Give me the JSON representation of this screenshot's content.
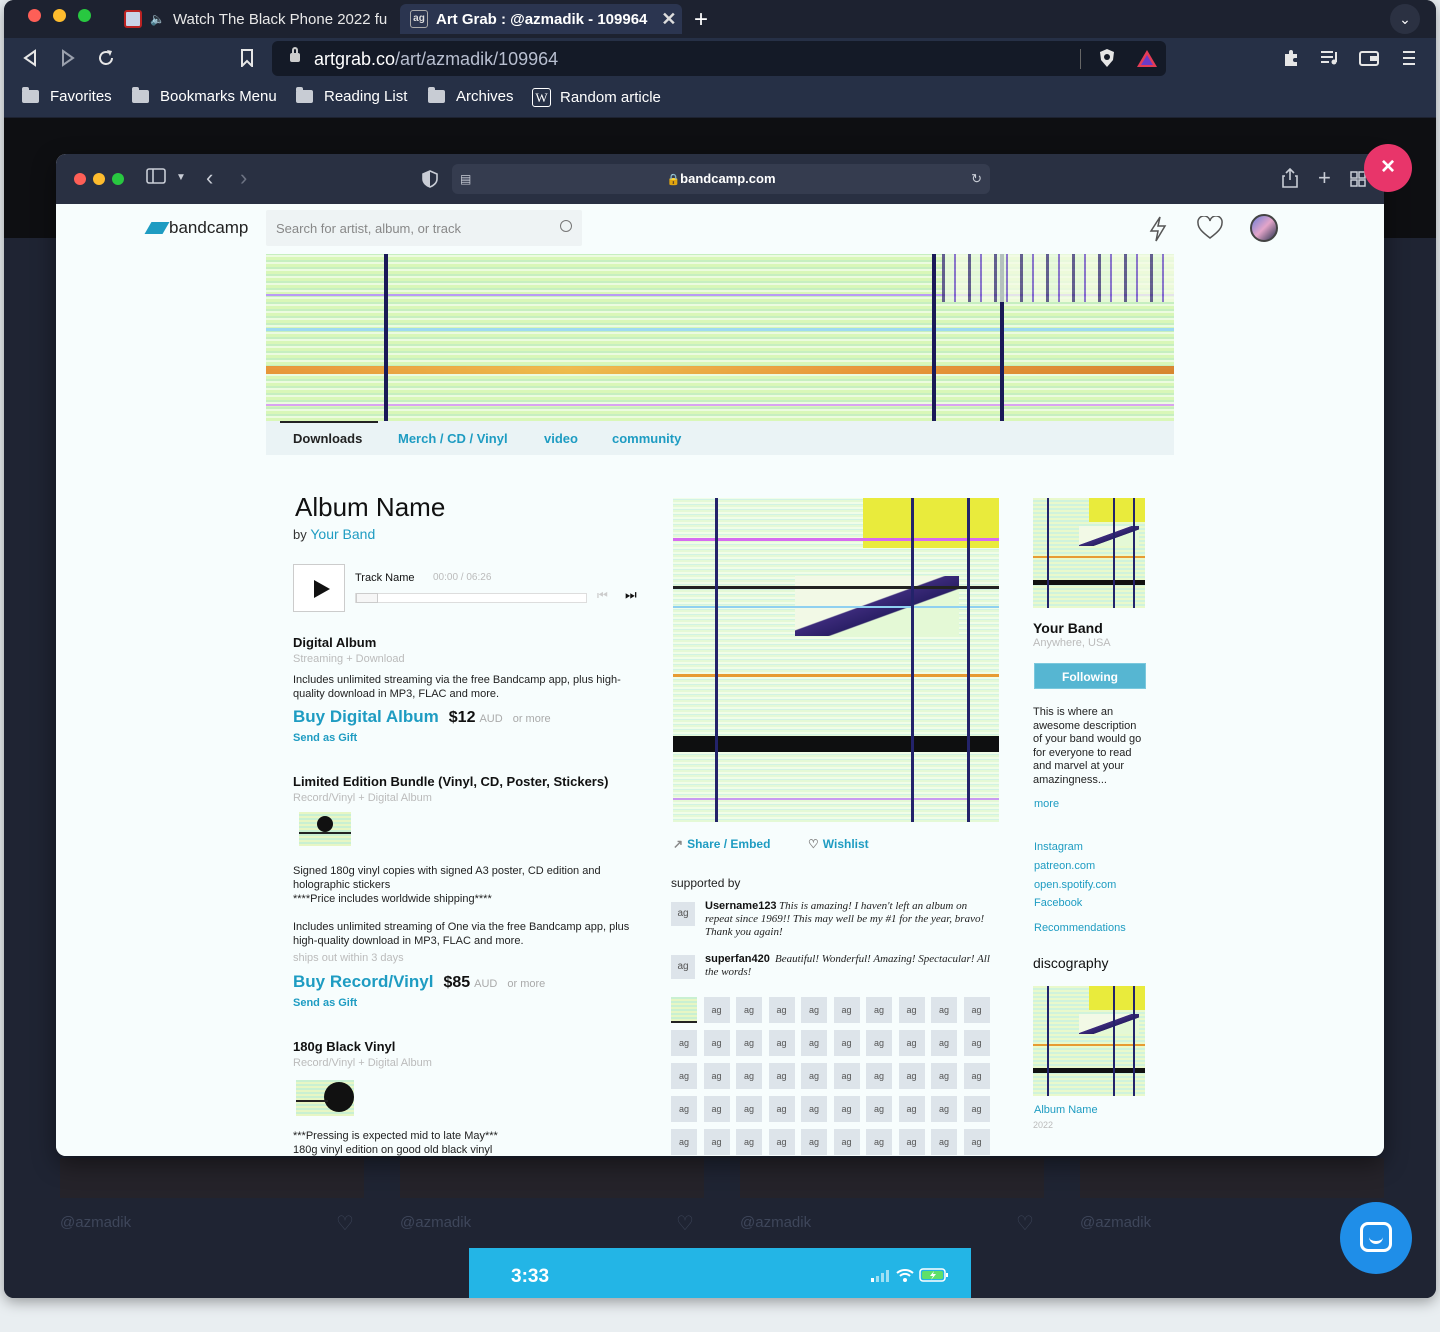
{
  "browser": {
    "tabs": [
      {
        "label": "Watch The Black Phone 2022 fu",
        "audio": "🔈"
      },
      {
        "label": "Art Grab : @azmadik - 109964",
        "close": "✕"
      }
    ],
    "new_tab": "+",
    "tab_menu": "⌄",
    "url_domain": "artgrab.co",
    "url_path": "/art/azmadik/109964",
    "bookmarks": [
      {
        "label": "Favorites",
        "icon": "folder-icon"
      },
      {
        "label": "Bookmarks Menu",
        "icon": "folder-icon"
      },
      {
        "label": "Reading List",
        "icon": "folder-icon"
      },
      {
        "label": "Archives",
        "icon": "folder-icon"
      },
      {
        "label": "Random article",
        "icon": "wikipedia-icon",
        "icon_glyph": "W"
      }
    ]
  },
  "overlay": {
    "close_glyph": "×",
    "usernames": [
      "@azmadik",
      "@azmadik",
      "@azmadik",
      "@azmadik"
    ],
    "phone_time": "3:33"
  },
  "inner_window": {
    "address": "bandcamp.com"
  },
  "bandcamp": {
    "logo": "bandcamp",
    "search_placeholder": "Search for artist, album, or track",
    "tabs": [
      "Downloads",
      "Merch / CD / Vinyl",
      "video",
      "community"
    ],
    "album_title": "Album Name",
    "by_prefix": "by",
    "artist": "Your Band",
    "player": {
      "track": "Track Name",
      "time": "00:00 / 06:26"
    },
    "digital": {
      "title": "Digital Album",
      "subtitle": "Streaming + Download",
      "desc": "Includes unlimited streaming via the free Bandcamp app, plus high-quality download in MP3, FLAC and more.",
      "buy": "Buy Digital Album",
      "price": "$12",
      "currency": "AUD",
      "more": "or more",
      "gift": "Send as Gift"
    },
    "bundle": {
      "title": "Limited Edition Bundle (Vinyl, CD, Poster, Stickers)",
      "subtitle": "Record/Vinyl + Digital Album",
      "desc1": "Signed 180g vinyl copies with signed A3 poster, CD edition and holographic stickers",
      "desc2": "****Price includes worldwide shipping****",
      "desc3": "Includes unlimited streaming of One via the free Bandcamp app, plus high-quality download in MP3, FLAC and more.",
      "ships": "ships out within 3 days",
      "buy": "Buy Record/Vinyl",
      "price": "$85",
      "currency": "AUD",
      "more": "or more",
      "gift": "Send as Gift"
    },
    "vinyl": {
      "title": "180g Black Vinyl",
      "subtitle": "Record/Vinyl + Digital Album",
      "desc1": "***Pressing is expected mid to late May***",
      "desc2": "180g vinyl edition on good old black vinyl"
    },
    "share": "Share / Embed",
    "wishlist": "Wishlist",
    "supported_by": "supported by",
    "supporters": [
      {
        "name": "Username123",
        "comment": "This is amazing! I haven't left an album on repeat since 1969!! This may well be my #1 for the year, bravo! Thank you again!"
      },
      {
        "name": "superfan420",
        "comment": "Beautiful! Wonderful! Amazing! Spectacular! All the words!"
      }
    ],
    "supporter_avatar_glyph": "ag",
    "band": {
      "name": "Your Band",
      "location": "Anywhere, USA",
      "follow": "Following",
      "description": "This is where an awesome description of your band would go for everyone to read and marvel at your amazingness...",
      "more": "more",
      "links": [
        "Instagram",
        "patreon.com",
        "open.spotify.com",
        "Facebook"
      ],
      "recommendations": "Recommendations",
      "discography": "discography",
      "disco_album": "Album Name",
      "disco_year": "2022"
    }
  }
}
